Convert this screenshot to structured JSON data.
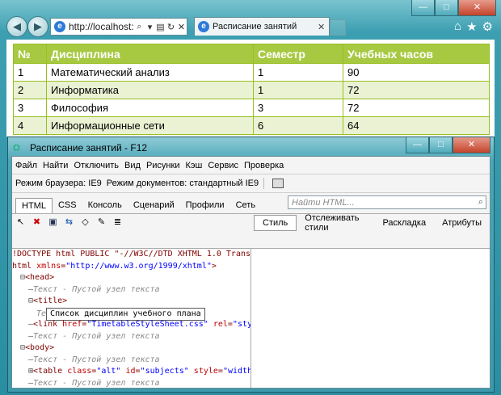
{
  "browser": {
    "address": "http://localhost:",
    "tab_title": "Расписание занятий",
    "win_controls": [
      "—",
      "□",
      "✕"
    ],
    "icons": [
      "back-icon",
      "forward-icon",
      "search-icon",
      "refresh-icon",
      "home-icon",
      "star-icon",
      "gear-icon"
    ]
  },
  "table": {
    "headers": [
      "№",
      "Дисциплина",
      "Семестр",
      "Учебных часов"
    ],
    "rows": [
      [
        "1",
        "Математический анализ",
        "1",
        "90"
      ],
      [
        "2",
        "Информатика",
        "1",
        "72"
      ],
      [
        "3",
        "Философия",
        "3",
        "72"
      ],
      [
        "4",
        "Информационные сети",
        "6",
        "64"
      ]
    ],
    "colors": {
      "header_bg": "#a7c942",
      "alt_row": "#eaf2d3"
    }
  },
  "devtools": {
    "title": "Расписание занятий - F12",
    "menu": [
      "Файл",
      "Найти",
      "Отключить",
      "Вид",
      "Рисунки",
      "Кэш",
      "Сервис",
      "Проверка"
    ],
    "browser_mode": "Режим браузера: IE9",
    "doc_mode": "Режим документов: стандартный IE9",
    "tabs": [
      "HTML",
      "CSS",
      "Консоль",
      "Сценарий",
      "Профили",
      "Сеть"
    ],
    "search_placeholder": "Найти HTML...",
    "style_tabs": [
      "Стиль",
      "Отслеживать стили",
      "Раскладка",
      "Атрибуты"
    ],
    "code_lines": [
      {
        "indent": 0,
        "parts": [
          [
            "tg",
            "!DOCTYPE html PUBLIC \"-//W3C//DTD XHTML 1.0 Trans"
          ]
        ]
      },
      {
        "indent": 0,
        "parts": [
          [
            "tg",
            "html "
          ],
          [
            "at",
            "xmlns"
          ],
          [
            "tg",
            "="
          ],
          [
            "av",
            "\"http://www.w3.org/1999/xhtml\""
          ],
          [
            "tg",
            ">"
          ]
        ]
      },
      {
        "indent": 1,
        "prefix": "⊟",
        "parts": [
          [
            "tg",
            "<head>"
          ]
        ]
      },
      {
        "indent": 2,
        "prefix": "—",
        "parts": [
          [
            "tx",
            "Текст - Пустой узел текста"
          ]
        ]
      },
      {
        "indent": 2,
        "prefix": "⊟",
        "parts": [
          [
            "tg",
            "<title>"
          ]
        ]
      },
      {
        "indent": 3,
        "edit": true,
        "parts": [
          [
            "tx",
            "Те"
          ]
        ],
        "edit_text": "Список дисциплин учебного плана"
      },
      {
        "indent": 2,
        "prefix": "—",
        "parts": [
          [
            "tg",
            "<link "
          ],
          [
            "at",
            "href"
          ],
          [
            "tg",
            "="
          ],
          [
            "av",
            "\"TimetableStyleSheet.css\""
          ],
          [
            "tg",
            " "
          ],
          [
            "at",
            "rel"
          ],
          [
            "tg",
            "="
          ],
          [
            "av",
            "\"sty"
          ]
        ]
      },
      {
        "indent": 2,
        "prefix": "—",
        "parts": [
          [
            "tx",
            "Текст - Пустой узел текста"
          ]
        ]
      },
      {
        "indent": 1,
        "prefix": "⊟",
        "parts": [
          [
            "tg",
            "<body>"
          ]
        ]
      },
      {
        "indent": 2,
        "prefix": "—",
        "parts": [
          [
            "tx",
            "Текст - Пустой узел текста"
          ]
        ]
      },
      {
        "indent": 2,
        "prefix": "⊞",
        "parts": [
          [
            "tg",
            "<table "
          ],
          [
            "at",
            "class"
          ],
          [
            "tg",
            "="
          ],
          [
            "av",
            "\"alt\""
          ],
          [
            "tg",
            " "
          ],
          [
            "at",
            "id"
          ],
          [
            "tg",
            "="
          ],
          [
            "av",
            "\"subjects\""
          ],
          [
            "tg",
            " "
          ],
          [
            "at",
            "style"
          ],
          [
            "tg",
            "="
          ],
          [
            "av",
            "\"width"
          ]
        ]
      },
      {
        "indent": 2,
        "prefix": "—",
        "parts": [
          [
            "tx",
            "Текст - Пустой узел текста"
          ]
        ]
      }
    ]
  }
}
